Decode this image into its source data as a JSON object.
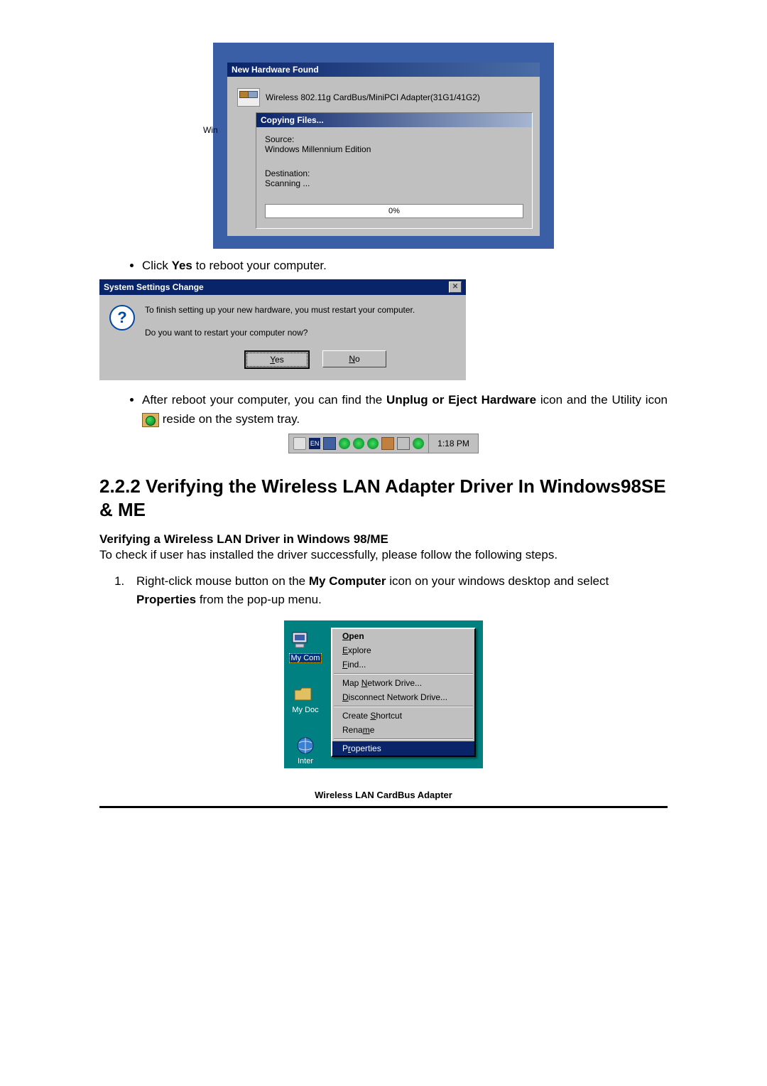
{
  "hwfound": {
    "title": "New Hardware Found",
    "device": "Wireless 802.11g CardBus/MiniPCI Adapter(31G1/41G2)",
    "win_label": "Win",
    "copying_title": "Copying Files...",
    "source_label": "Source:",
    "source_value": "Windows Millennium Edition",
    "dest_label": "Destination:",
    "dest_value": "Scanning ...",
    "progress": "0%"
  },
  "bullets": {
    "click_yes_pre": "Click ",
    "click_yes_bold": "Yes",
    "click_yes_post": " to reboot your computer.",
    "after_reboot_pre": "After reboot your computer, you can find the ",
    "after_reboot_bold": "Unplug or Eject Hardware",
    "after_reboot_mid": " icon and the Utility icon ",
    "after_reboot_post": " reside on the system tray."
  },
  "settings_dlg": {
    "title": "System Settings Change",
    "msg1": "To finish setting up your new hardware, you must restart your computer.",
    "msg2": "Do you want to restart your computer now?",
    "yes": "Yes",
    "no": "No"
  },
  "tray": {
    "lang": "EN",
    "clock": "1:18 PM"
  },
  "section": {
    "heading": "2.2.2  Verifying the Wireless LAN Adapter Driver In Windows98SE & ME",
    "sub": "Verifying a Wireless LAN Driver in Windows 98/ME",
    "intro": "To check if user has installed the driver successfully, please follow the following steps.",
    "step1_pre": "Right-click mouse button on the ",
    "step1_bold1": "My Computer",
    "step1_mid": " icon on your windows desktop and select ",
    "step1_bold2": "Properties",
    "step1_post": " from the pop-up menu."
  },
  "desktop": {
    "mycomputer": "My Com",
    "mydocs": "My Doc",
    "inter": "Inter"
  },
  "ctx": {
    "open": "Open",
    "explore": "Explore",
    "find": "Find...",
    "map": "Map Network Drive...",
    "disconnect": "Disconnect Network Drive...",
    "shortcut": "Create Shortcut",
    "rename": "Rename",
    "properties": "Properties"
  },
  "footer": "Wireless LAN CardBus Adapter"
}
